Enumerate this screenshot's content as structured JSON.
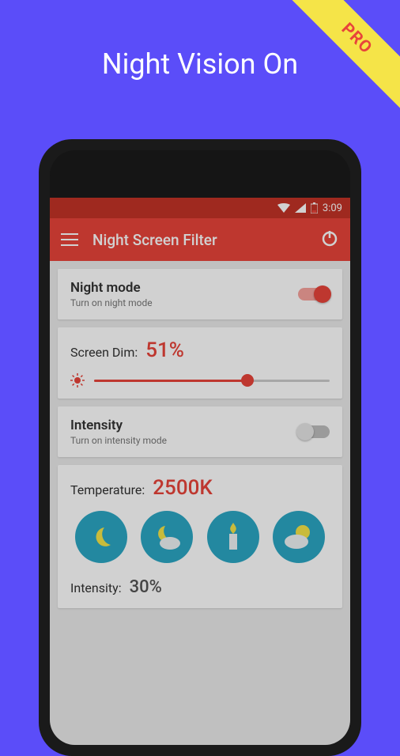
{
  "promo": {
    "headline": "Night Vision On",
    "ribbon": "PRO"
  },
  "statusbar": {
    "time": "3:09"
  },
  "appbar": {
    "title": "Night Screen Filter"
  },
  "night_mode": {
    "title": "Night mode",
    "subtitle": "Turn on night mode",
    "enabled": true
  },
  "screen_dim": {
    "label": "Screen Dim:",
    "value": "51%",
    "slider_percent": 65
  },
  "intensity_toggle": {
    "title": "Intensity",
    "subtitle": "Turn on intensity mode",
    "enabled": false
  },
  "temperature": {
    "label": "Temperature:",
    "value": "2500K",
    "icons": [
      "moon-icon",
      "moon-cloud-icon",
      "candle-icon",
      "sun-cloud-icon"
    ]
  },
  "intensity": {
    "label": "Intensity:",
    "value": "30%"
  }
}
